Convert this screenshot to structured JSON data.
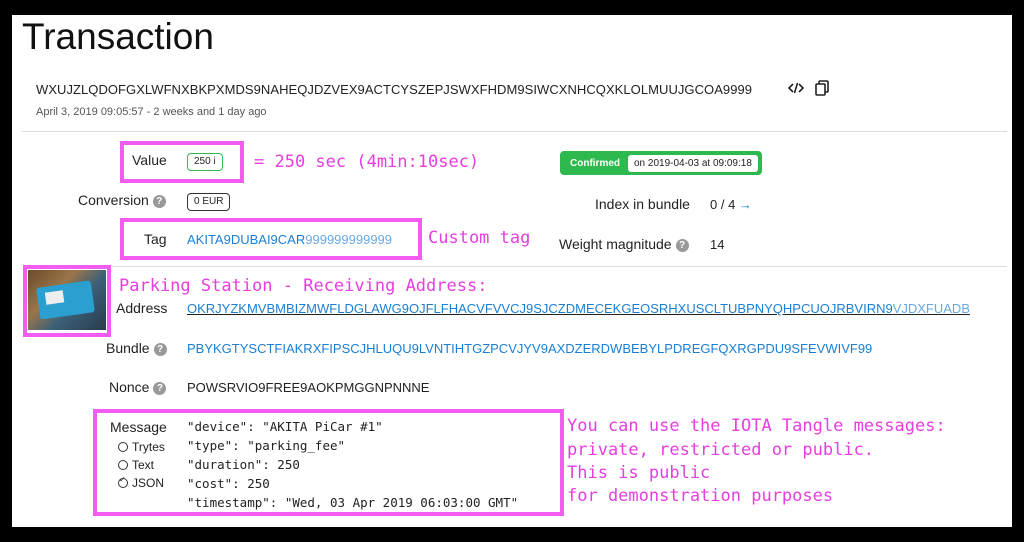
{
  "page": {
    "title": "Transaction",
    "hash": "WXUJZLQDOFGXLWFNXBKPXMDS9NAHEQJDZVEX9ACTCYSZEPJSWXFHDM9SIWCXNHCQXKLOLMUUJGCOA9999",
    "timestamp": "April 3, 2019 09:05:57 - 2 weeks and 1 day ago"
  },
  "fields": {
    "value_label": "Value",
    "value": "250 i",
    "conversion_label": "Conversion",
    "conversion": "0 EUR",
    "tag_label": "Tag",
    "tag_main": "AKITA9DUBAI9CAR",
    "tag_pad": "999999999999",
    "address_label": "Address",
    "address_main": "OKRJYZKMVBMBIZMWFLDGLAWG9OJFLFHACVFVVCJ9SJCZDMECEKGEOSRHXUSCLTUBPNYQHPCUOJRBVIRN9",
    "address_checksum": "VJDXFUADB",
    "bundle_label": "Bundle",
    "bundle": "PBYKGTYSCTFIAKRXFIPSCJHLUQU9LVNTIHTGZPCVJYV9AXDZERDWBEBYLPDREGFQXRGPDU9SFEVWIVF99",
    "nonce_label": "Nonce",
    "nonce": "POWSRVIO9FREE9AOKPMGGNPNNNE",
    "index_label": "Index in bundle",
    "index": "0 / 4",
    "weight_label": "Weight magnitude",
    "weight": "14",
    "status": "Confirmed",
    "status_date": "on 2019-04-03 at 09:09:18",
    "message_label": "Message",
    "message_options": [
      "Trytes",
      "Text",
      "JSON"
    ],
    "message_selected": "JSON",
    "message_lines": [
      "\"device\": \"AKITA PiCar #1\"",
      "\"type\": \"parking_fee\"",
      "\"duration\": 250",
      "\"cost\": 250",
      "\"timestamp\": \"Wed, 03 Apr 2019 06:03:00 GMT\""
    ]
  },
  "annotations": {
    "value_note": "= 250 sec (4min:10sec)",
    "tag_note": "Custom tag",
    "address_note": "Parking Station - Receiving Address:",
    "message_note_1": "You can use the IOTA Tangle messages:",
    "message_note_2": "private, restricted or public.",
    "message_note_3": "This is public",
    "message_note_4": "for demonstration purposes"
  },
  "colors": {
    "annotation": "#e83de0",
    "highlight_box": "#f25cf0",
    "confirmed": "#2db94d",
    "link": "#1a7fd4"
  },
  "icons": [
    "code-icon",
    "copy-icon",
    "help-icon",
    "arrow-right-icon"
  ]
}
